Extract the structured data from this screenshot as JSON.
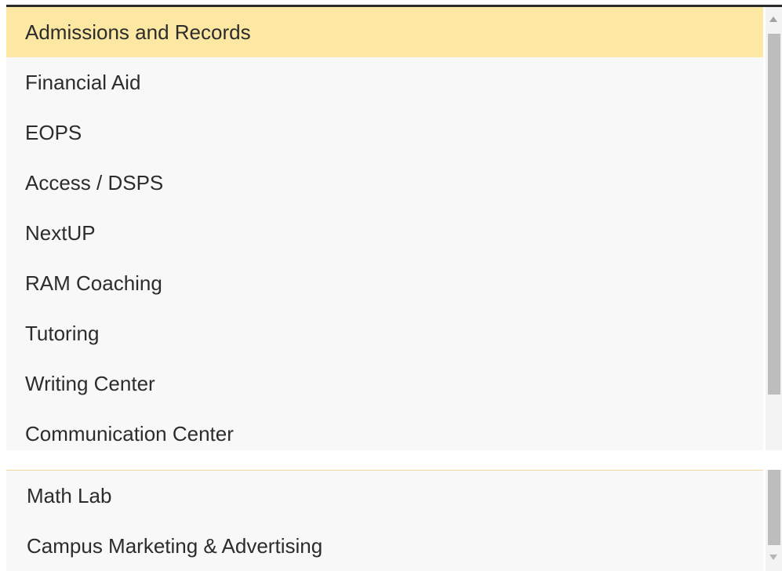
{
  "list": {
    "items": [
      {
        "label": "Admissions and Records"
      },
      {
        "label": "Financial Aid"
      },
      {
        "label": "EOPS"
      },
      {
        "label": "Access / DSPS"
      },
      {
        "label": "NextUP"
      },
      {
        "label": "RAM Coaching"
      },
      {
        "label": "Tutoring"
      },
      {
        "label": "Writing Center"
      },
      {
        "label": "Communication Center"
      }
    ],
    "selected_index": 0
  },
  "list_continued": {
    "items": [
      {
        "label": "Math Lab"
      },
      {
        "label": "Campus Marketing & Advertising"
      }
    ]
  },
  "colors": {
    "selected_background": "#fce7a3",
    "list_background": "#f8f8f8",
    "text": "#2c2c2c",
    "scrollbar_thumb": "#bdbdbd"
  },
  "icons": {
    "scroll_up": "scroll-up-arrow-icon",
    "scroll_down": "scroll-down-arrow-icon"
  }
}
